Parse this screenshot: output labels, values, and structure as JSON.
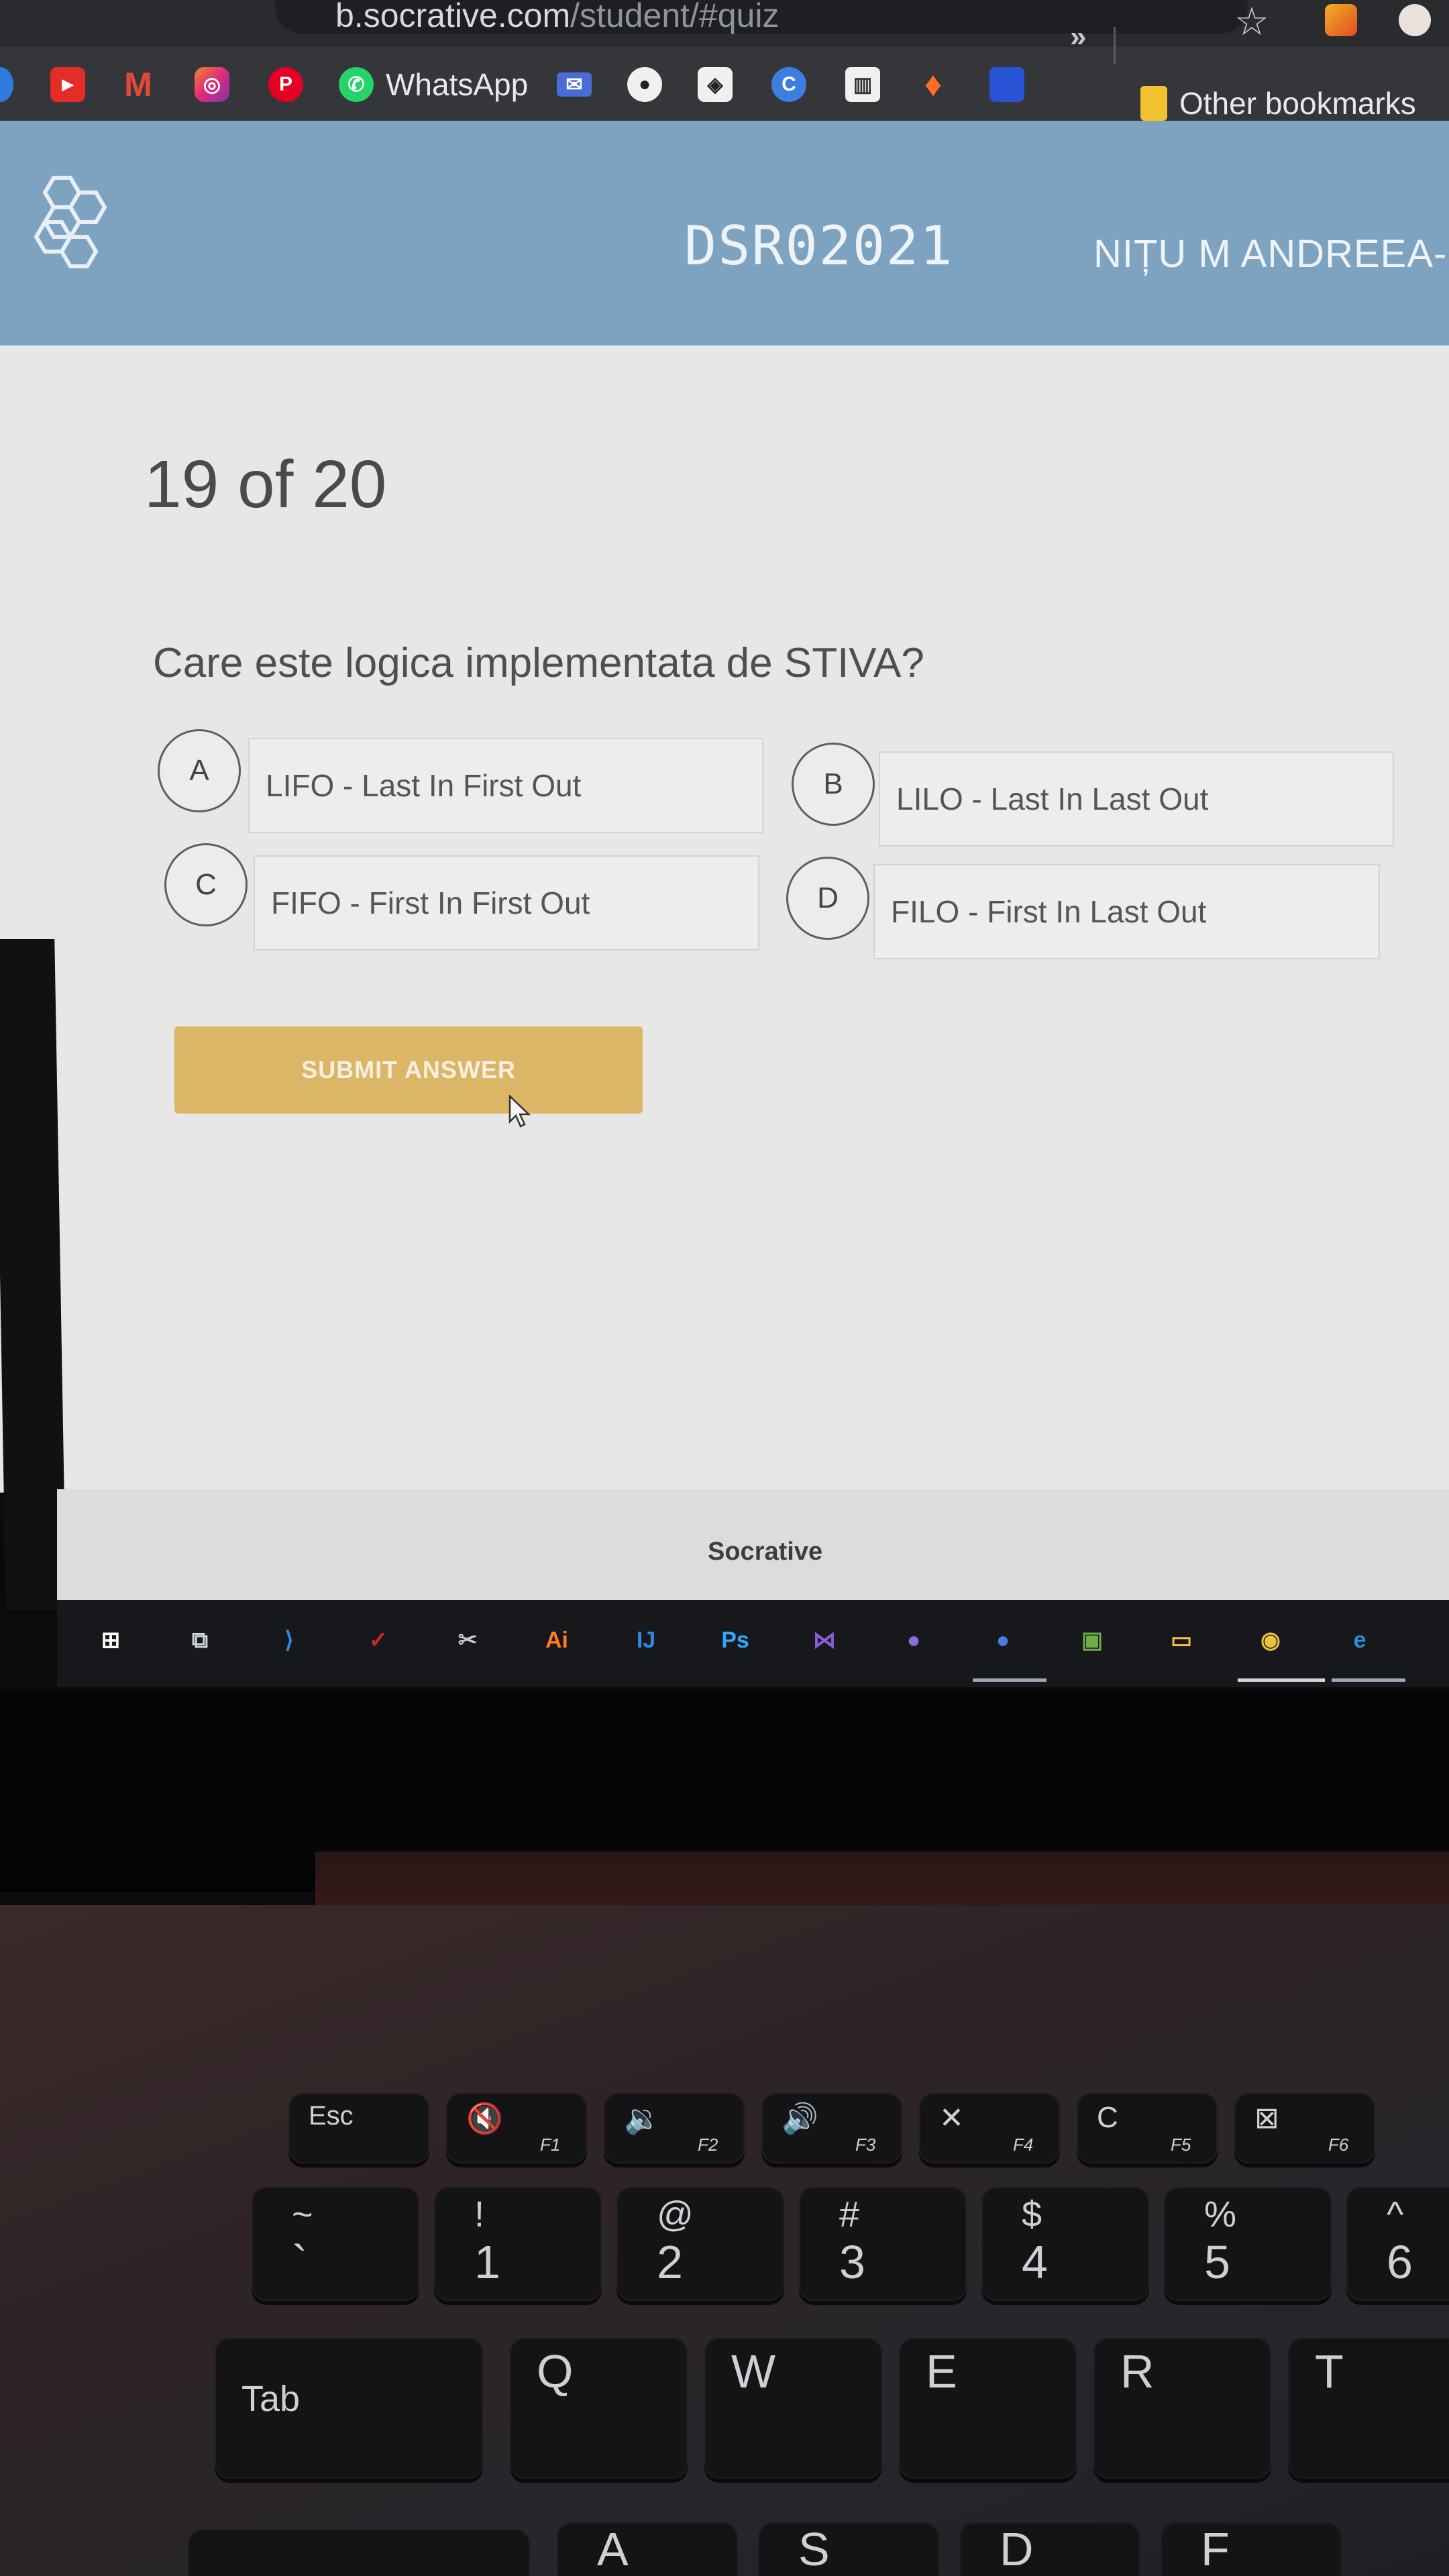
{
  "browser": {
    "url_host": "b.socrative.com",
    "url_path": "/student/#quiz",
    "bookmarks": [
      {
        "icon": "youtube-icon",
        "label": ""
      },
      {
        "icon": "gmail-icon",
        "label": ""
      },
      {
        "icon": "instagram-icon",
        "label": ""
      },
      {
        "icon": "pinterest-icon",
        "label": ""
      },
      {
        "icon": "whatsapp-icon",
        "label": "WhatsApp"
      },
      {
        "icon": "mail-icon",
        "label": ""
      },
      {
        "icon": "github-icon",
        "label": ""
      },
      {
        "icon": "codepen-icon",
        "label": ""
      },
      {
        "icon": "c-icon",
        "label": ""
      },
      {
        "icon": "trello-icon",
        "label": ""
      },
      {
        "icon": "gitlab-icon",
        "label": ""
      },
      {
        "icon": "bookmark-icon",
        "label": ""
      }
    ],
    "more_bookmarks": "»",
    "other_bookmarks": "Other bookmarks"
  },
  "header": {
    "room_name": "DSR02021",
    "student_name": "NIȚU M ANDREEA-BIA"
  },
  "quiz": {
    "progress": "19 of 20",
    "question": "Care este logica implementata de STIVA?",
    "options": [
      {
        "letter": "A",
        "text": "LIFO - Last In First Out"
      },
      {
        "letter": "B",
        "text": "LILO - Last In Last Out"
      },
      {
        "letter": "C",
        "text": "FIFO - First In First Out"
      },
      {
        "letter": "D",
        "text": "FILO - First In Last Out"
      }
    ],
    "submit_label": "SUBMIT ANSWER"
  },
  "footer": {
    "brand": "Socrative"
  },
  "taskbar": {
    "apps": [
      {
        "icon": "windows-start-icon",
        "glyph": "⊞"
      },
      {
        "icon": "task-view-icon",
        "glyph": "⧉"
      },
      {
        "icon": "vscode-icon",
        "glyph": "⟩"
      },
      {
        "icon": "todo-icon",
        "glyph": "✓"
      },
      {
        "icon": "snip-tool-icon",
        "glyph": "✂"
      },
      {
        "icon": "illustrator-icon",
        "glyph": "Ai"
      },
      {
        "icon": "intellij-icon",
        "glyph": "IJ"
      },
      {
        "icon": "photoshop-icon",
        "glyph": "Ps"
      },
      {
        "icon": "visual-studio-icon",
        "glyph": "⋈"
      },
      {
        "icon": "github-desktop-icon",
        "glyph": "●"
      },
      {
        "icon": "chrome-profile-icon",
        "glyph": "●"
      },
      {
        "icon": "image-viewer-icon",
        "glyph": "▣"
      },
      {
        "icon": "file-explorer-icon",
        "glyph": "▭"
      },
      {
        "icon": "chrome-icon",
        "glyph": "◉"
      },
      {
        "icon": "edge-icon",
        "glyph": "e"
      }
    ]
  },
  "keyboard": {
    "fn_row": [
      {
        "main": "Esc",
        "fn": ""
      },
      {
        "main": "🔇",
        "fn": "F1"
      },
      {
        "main": "🔉",
        "fn": "F2"
      },
      {
        "main": "🔊",
        "fn": "F3"
      },
      {
        "main": "✕",
        "fn": "F4"
      },
      {
        "main": "C",
        "fn": "F5"
      },
      {
        "main": "⊠",
        "fn": "F6"
      }
    ],
    "number_row": [
      {
        "shift": "~",
        "main": "`"
      },
      {
        "shift": "!",
        "main": "1"
      },
      {
        "shift": "@",
        "main": "2"
      },
      {
        "shift": "#",
        "main": "3"
      },
      {
        "shift": "$",
        "main": "4"
      },
      {
        "shift": "%",
        "main": "5"
      },
      {
        "shift": "^",
        "main": "6"
      }
    ],
    "letter_row": [
      "Tab",
      "Q",
      "W",
      "E",
      "R",
      "T"
    ],
    "bottom_row": [
      "A",
      "S",
      "D",
      "F"
    ]
  },
  "colors": {
    "header_bg": "#7ea3c1",
    "submit_bg": "#dcb667",
    "page_bg": "#e7e7e5"
  }
}
